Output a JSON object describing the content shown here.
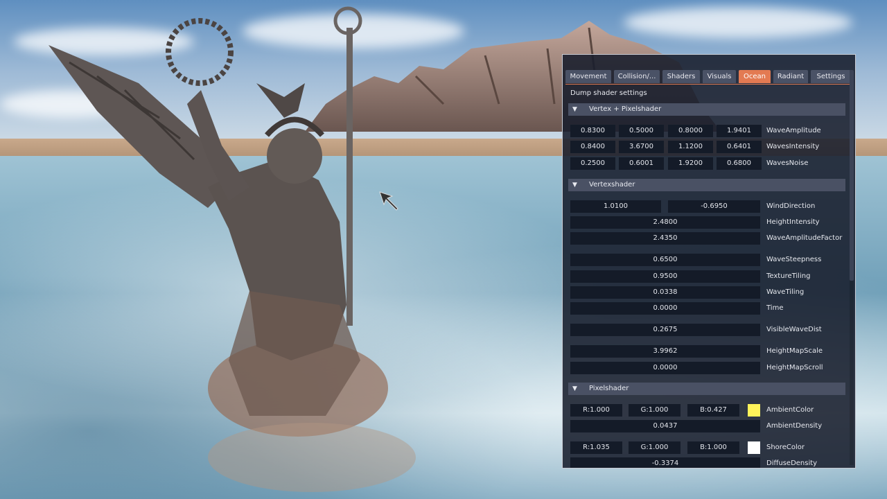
{
  "tabs": [
    {
      "label": "Movement",
      "active": false
    },
    {
      "label": "Collision/...",
      "active": false
    },
    {
      "label": "Shaders",
      "active": false
    },
    {
      "label": "Visuals",
      "active": false
    },
    {
      "label": "Ocean",
      "active": true
    },
    {
      "label": "Radiant",
      "active": false
    },
    {
      "label": "Settings",
      "active": false
    }
  ],
  "dump_label": "Dump shader settings",
  "sections": {
    "vertex_pixel": "Vertex + Pixelshader",
    "vertex": "Vertexshader",
    "pixel": "Pixelshader"
  },
  "vp_rows": [
    {
      "values": [
        "0.8300",
        "0.5000",
        "0.8000",
        "1.9401"
      ],
      "label": "WaveAmplitude"
    },
    {
      "values": [
        "0.8400",
        "3.6700",
        "1.1200",
        "0.6401"
      ],
      "label": "WavesIntensity"
    },
    {
      "values": [
        "0.2500",
        "0.6001",
        "1.9200",
        "0.6800"
      ],
      "label": "WavesNoise"
    }
  ],
  "wind": {
    "values": [
      "1.0100",
      "-0.6950"
    ],
    "label": "WindDirection"
  },
  "v_rows": [
    {
      "value": "2.4800",
      "label": "HeightIntensity"
    },
    {
      "value": "2.4350",
      "label": "WaveAmplitudeFactor"
    },
    {
      "value": "0.6500",
      "label": "WaveSteepness"
    },
    {
      "value": "0.9500",
      "label": "TextureTiling"
    },
    {
      "value": "0.0338",
      "label": "WaveTiling"
    },
    {
      "value": "0.0000",
      "label": "Time"
    },
    {
      "value": "0.2675",
      "label": "VisibleWaveDist"
    },
    {
      "value": "3.9962",
      "label": "HeightMapScale"
    },
    {
      "value": "0.0000",
      "label": "HeightMapScroll"
    }
  ],
  "ambient_color": {
    "r": "R:1.000",
    "g": "G:1.000",
    "b": "B:0.427",
    "label": "AmbientColor",
    "swatch": "#fff35a"
  },
  "ambient_density": {
    "value": "0.0437",
    "label": "AmbientDensity"
  },
  "shore_color": {
    "r": "R:1.035",
    "g": "G:1.000",
    "b": "B:1.000",
    "label": "ShoreColor",
    "swatch": "#ffffff"
  },
  "diffuse_density": {
    "value": "-0.3374",
    "label": "DiffuseDensity"
  },
  "colors": {
    "accent": "#e37a52",
    "panel": "#181e2c",
    "field": "#141b28",
    "section": "#4a5164"
  }
}
